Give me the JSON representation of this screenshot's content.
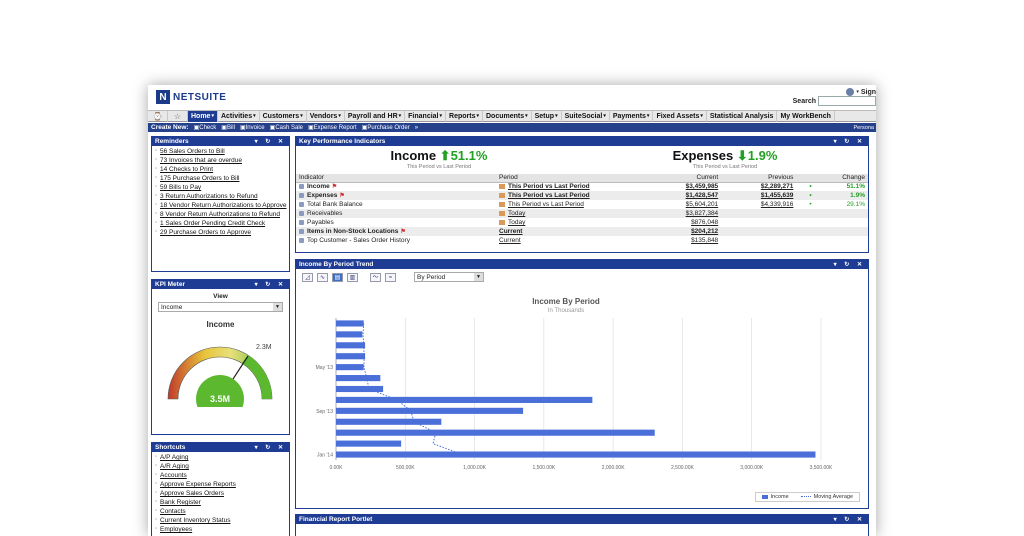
{
  "header": {
    "logo_text": "NETSUITE",
    "logo_mark": "N",
    "sign_out": "Sign",
    "search_label": "Search",
    "search_value": ""
  },
  "nav": {
    "icons": [
      "clock-icon",
      "star-icon"
    ],
    "items": [
      {
        "label": "Home",
        "active": true
      },
      {
        "label": "Activities"
      },
      {
        "label": "Customers"
      },
      {
        "label": "Vendors"
      },
      {
        "label": "Payroll and HR"
      },
      {
        "label": "Financial"
      },
      {
        "label": "Reports"
      },
      {
        "label": "Documents"
      },
      {
        "label": "Setup"
      },
      {
        "label": "SuiteSocial"
      },
      {
        "label": "Payments"
      },
      {
        "label": "Fixed Assets"
      },
      {
        "label": "Statistical Analysis",
        "nocaret": true
      },
      {
        "label": "My WorkBench",
        "nocaret": true
      }
    ]
  },
  "create_new": {
    "label": "Create New:",
    "items": [
      "Check",
      "Bill",
      "Invoice",
      "Cash Sale",
      "Expense Report",
      "Purchase Order"
    ],
    "more": "»",
    "personal": "Persona"
  },
  "reminders": {
    "title": "Reminders",
    "items": [
      "56 Sales Orders to Bill",
      "73 Invoices that are overdue",
      "14 Checks to Print",
      "175 Purchase Orders to Bill",
      "59 Bills to Pay",
      "3 Return Authorizations to Refund",
      "18 Vendor Return Authorizations to Approve",
      "8 Vendor Return Authorizations to Refund",
      "1 Sales Order Pending Credit Check",
      "29 Purchase Orders to Approve"
    ]
  },
  "kpi_meter": {
    "title": "KPI Meter",
    "view_label": "View",
    "view_value": "Income",
    "gauge_title": "Income",
    "gauge_value": "3.5M",
    "gauge_target": "2.3M"
  },
  "shortcuts": {
    "title": "Shortcuts",
    "items": [
      "A/P Aging",
      "A/R Aging",
      "Accounts",
      "Approve Expense Reports",
      "Approve Sales Orders",
      "Bank Register",
      "Contacts",
      "Current Inventory Status",
      "Employees"
    ]
  },
  "kpi": {
    "title": "Key Performance Indicators",
    "income_label": "Income",
    "income_change": "51.1%",
    "income_arrow": "⬆",
    "expenses_label": "Expenses",
    "expenses_change": "1.9%",
    "expenses_arrow": "⬇",
    "compare_label": "This Period vs Last Period",
    "columns": [
      "Indicator",
      "Period",
      "Current",
      "Previous",
      "Change"
    ],
    "rows": [
      {
        "indicator": "Income",
        "period": "This Period vs Last Period",
        "current": "$3,459,985",
        "previous": "$2,289,271",
        "change": "51.1%",
        "bold": true,
        "flag": true,
        "pbox": true,
        "shade": false
      },
      {
        "indicator": "Expenses",
        "period": "This Period vs Last Period",
        "current": "$1,428,547",
        "previous": "$1,455,639",
        "change": "1.9%",
        "bold": true,
        "flag": true,
        "pbox": true,
        "shade": true
      },
      {
        "indicator": "Total Bank Balance",
        "period": "This Period vs Last Period",
        "current": "$5,604,201",
        "previous": "$4,339,916",
        "change": "29.1%",
        "bold": false,
        "flag": false,
        "pbox": true,
        "shade": false
      },
      {
        "indicator": "Receivables",
        "period": "Today",
        "current": "$3,827,384",
        "previous": "",
        "change": "",
        "bold": false,
        "flag": false,
        "pbox": true,
        "shade": true
      },
      {
        "indicator": "Payables",
        "period": "Today",
        "current": "$876,048",
        "previous": "",
        "change": "",
        "bold": false,
        "flag": false,
        "pbox": true,
        "shade": false
      },
      {
        "indicator": "Items in Non-Stock Locations",
        "period": "Current",
        "current": "$204,212",
        "previous": "",
        "change": "",
        "bold": true,
        "flag": true,
        "pbox": false,
        "shade": true
      },
      {
        "indicator": "Top Customer - Sales Order History",
        "period": "Current",
        "current": "$135,848",
        "previous": "",
        "change": "",
        "bold": false,
        "flag": false,
        "pbox": false,
        "shade": false
      }
    ]
  },
  "trend": {
    "title": "Income By Period Trend",
    "select_value": "By Period"
  },
  "financial": {
    "title": "Financial Report Portlet"
  },
  "chart_data": {
    "type": "bar",
    "orientation": "horizontal",
    "title": "Income By Period",
    "subtitle": "In Thousands",
    "x_ticks": [
      "0.00K",
      "500.00K",
      "1,000.00K",
      "1,500.00K",
      "2,000.00K",
      "2,500.00K",
      "3,000.00K",
      "3,500.00K"
    ],
    "xlim": [
      0,
      3500
    ],
    "y_ticks": [
      {
        "label": "May '13",
        "index": 4
      },
      {
        "label": "Sep '13",
        "index": 8
      },
      {
        "label": "Jan '14",
        "index": 12
      }
    ],
    "series": [
      {
        "name": "Income",
        "values": [
          200,
          190,
          210,
          210,
          200,
          320,
          340,
          1850,
          1350,
          760,
          2300,
          470,
          3460
        ]
      },
      {
        "name": "Moving Average",
        "values": [
          200,
          195,
          200,
          203,
          202,
          222,
          238,
          440,
          540,
          562,
          720,
          700,
          910
        ]
      }
    ],
    "legend_position": "bottom-right",
    "grid": true
  },
  "colors": {
    "brand": "#1f3c95",
    "bar": "#4a6fd8",
    "gauge_green": "#5cb82f"
  }
}
